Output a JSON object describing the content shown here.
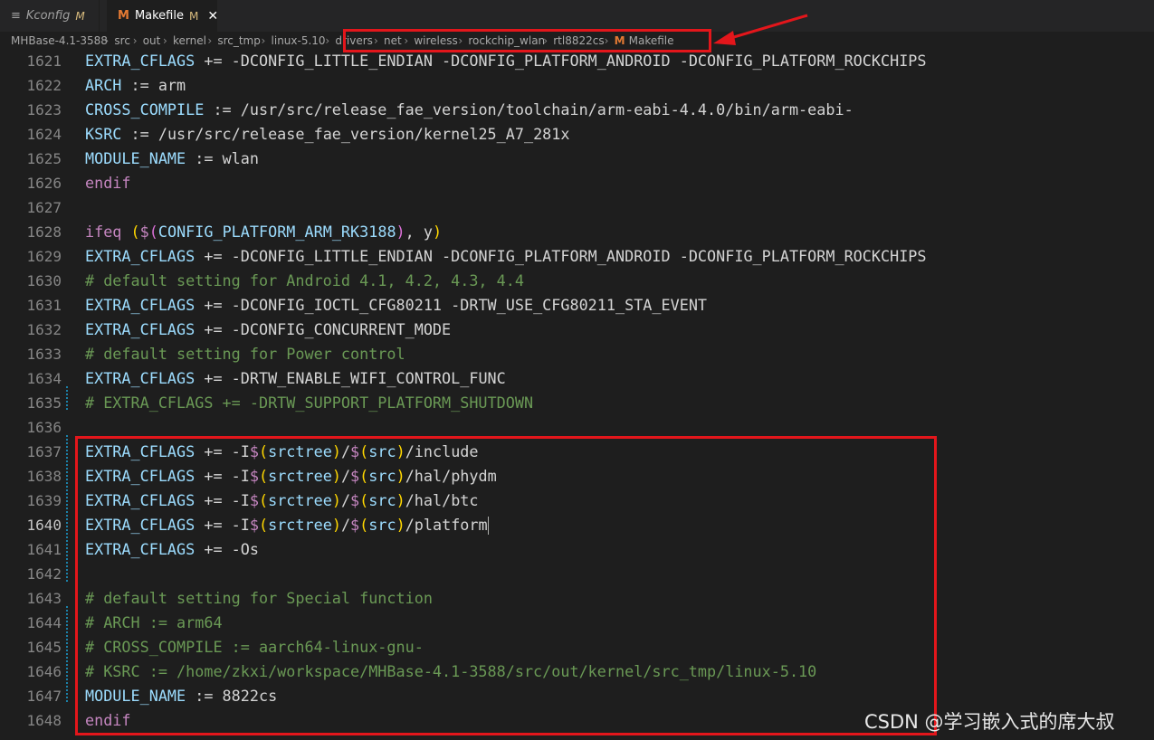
{
  "tabs": [
    {
      "label": "Kconfig",
      "modified": "M",
      "icon": "list-icon"
    },
    {
      "label": "Makefile",
      "modified": "M",
      "icon": "makefile-icon",
      "active": true
    }
  ],
  "breadcrumb": [
    "MHBase-4.1-3588",
    "src",
    "out",
    "kernel",
    "src_tmp",
    "linux-5.10",
    "drivers",
    "net",
    "wireless",
    "rockchip_wlan",
    "rtl8822cs",
    "Makefile"
  ],
  "breadcrumb_file_icon": "M",
  "lines": [
    {
      "n": "1621",
      "text": "EXTRA_CFLAGS += -DCONFIG_LITTLE_ENDIAN -DCONFIG_PLATFORM_ANDROID -DCONFIG_PLATFORM_ROCKCHIPS"
    },
    {
      "n": "1622",
      "text": "ARCH := arm"
    },
    {
      "n": "1623",
      "text": "CROSS_COMPILE := /usr/src/release_fae_version/toolchain/arm-eabi-4.4.0/bin/arm-eabi-"
    },
    {
      "n": "1624",
      "text": "KSRC := /usr/src/release_fae_version/kernel25_A7_281x"
    },
    {
      "n": "1625",
      "text": "MODULE_NAME := wlan"
    },
    {
      "n": "1626",
      "text": "endif"
    },
    {
      "n": "1627",
      "text": ""
    },
    {
      "n": "1628",
      "text": "ifeq ($(CONFIG_PLATFORM_ARM_RK3188), y)"
    },
    {
      "n": "1629",
      "text": "EXTRA_CFLAGS += -DCONFIG_LITTLE_ENDIAN -DCONFIG_PLATFORM_ANDROID -DCONFIG_PLATFORM_ROCKCHIPS"
    },
    {
      "n": "1630",
      "text": "# default setting for Android 4.1, 4.2, 4.3, 4.4"
    },
    {
      "n": "1631",
      "text": "EXTRA_CFLAGS += -DCONFIG_IOCTL_CFG80211 -DRTW_USE_CFG80211_STA_EVENT"
    },
    {
      "n": "1632",
      "text": "EXTRA_CFLAGS += -DCONFIG_CONCURRENT_MODE"
    },
    {
      "n": "1633",
      "text": "# default setting for Power control"
    },
    {
      "n": "1634",
      "text": "EXTRA_CFLAGS += -DRTW_ENABLE_WIFI_CONTROL_FUNC"
    },
    {
      "n": "1635",
      "text": "# EXTRA_CFLAGS += -DRTW_SUPPORT_PLATFORM_SHUTDOWN"
    },
    {
      "n": "1636",
      "text": ""
    },
    {
      "n": "1637",
      "text": "EXTRA_CFLAGS += -I$(srctree)/$(src)/include"
    },
    {
      "n": "1638",
      "text": "EXTRA_CFLAGS += -I$(srctree)/$(src)/hal/phydm"
    },
    {
      "n": "1639",
      "text": "EXTRA_CFLAGS += -I$(srctree)/$(src)/hal/btc"
    },
    {
      "n": "1640",
      "text": "EXTRA_CFLAGS += -I$(srctree)/$(src)/platform"
    },
    {
      "n": "1641",
      "text": "EXTRA_CFLAGS += -Os"
    },
    {
      "n": "1642",
      "text": ""
    },
    {
      "n": "1643",
      "text": "# default setting for Special function"
    },
    {
      "n": "1644",
      "text": "# ARCH := arm64"
    },
    {
      "n": "1645",
      "text": "# CROSS_COMPILE := aarch64-linux-gnu-"
    },
    {
      "n": "1646",
      "text": "# KSRC := /home/zkxi/workspace/MHBase-4.1-3588/src/out/kernel/src_tmp/linux-5.10"
    },
    {
      "n": "1647",
      "text": "MODULE_NAME := 8822cs"
    },
    {
      "n": "1648",
      "text": "endif"
    }
  ],
  "current_line": "1640",
  "watermark": "CSDN @学习嵌入式的席大叔",
  "colors": {
    "accent_red": "#e3161b",
    "comment": "#6a9955",
    "keyword": "#c586c0",
    "variable": "#9cdcfe",
    "makefile_icon": "#e37933"
  }
}
